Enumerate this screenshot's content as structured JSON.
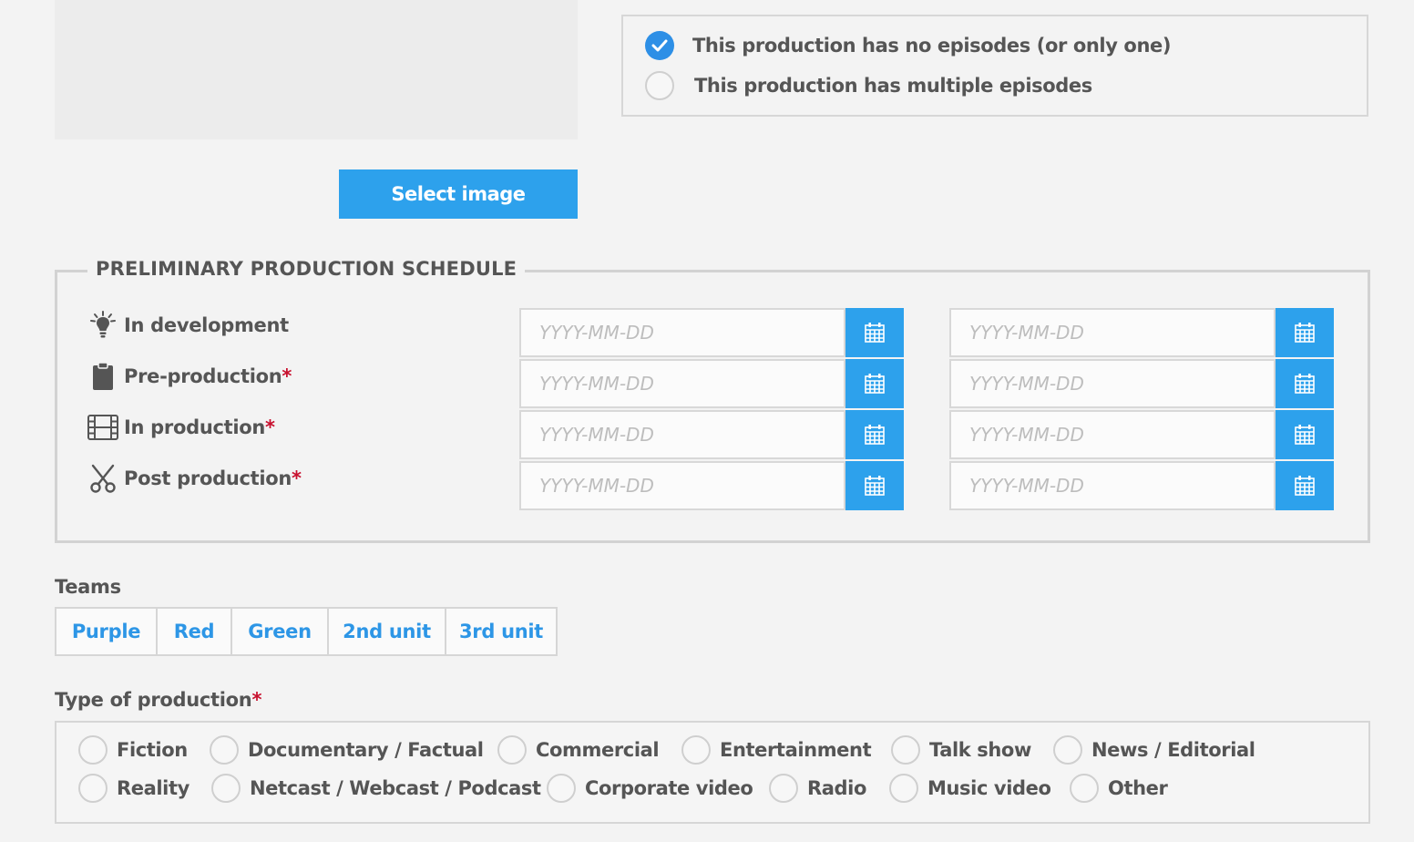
{
  "image": {
    "select_label": "Select image"
  },
  "episodes": {
    "options": [
      {
        "label": "This production has no episodes (or only one)",
        "selected": true
      },
      {
        "label": "This production has multiple episodes",
        "selected": false
      }
    ]
  },
  "schedule": {
    "title": "PRELIMINARY PRODUCTION SCHEDULE",
    "phases": [
      {
        "label": "In development",
        "required": false,
        "icon": "lightbulb-icon"
      },
      {
        "label": "Pre-production",
        "required": true,
        "icon": "clipboard-icon"
      },
      {
        "label": "In production",
        "required": true,
        "icon": "film-icon"
      },
      {
        "label": "Post production",
        "required": true,
        "icon": "scissors-icon"
      }
    ],
    "date_placeholder": "YYYY-MM-DD",
    "required_mark": "*"
  },
  "teams": {
    "label": "Teams",
    "items": [
      "Purple",
      "Red",
      "Green",
      "2nd unit",
      "3rd unit"
    ]
  },
  "production_type": {
    "label": "Type of production",
    "required_mark": "*",
    "options": [
      "Fiction",
      "Documentary / Factual",
      "Commercial",
      "Entertainment",
      "Talk show",
      "News / Editorial",
      "Reality",
      "Netcast / Webcast / Podcast",
      "Corporate video",
      "Radio",
      "Music video",
      "Other"
    ]
  },
  "colors": {
    "accent": "#2da1ec",
    "required": "#c8102e",
    "text": "#555555",
    "background": "#f3f3f3"
  }
}
